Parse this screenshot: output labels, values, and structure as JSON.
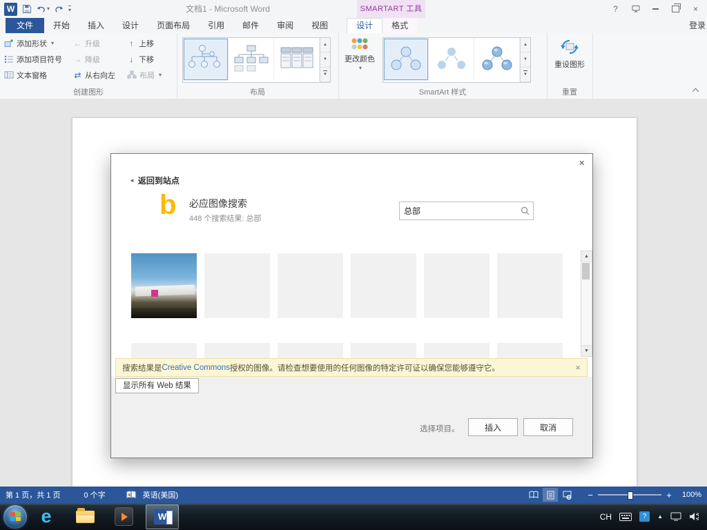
{
  "window": {
    "title": "文档1 - Microsoft Word",
    "contextual_tool_label": "SMARTART 工具",
    "sign_in": "登录"
  },
  "glyphs": {
    "close": "×",
    "dropdown": "▾",
    "up": "▲",
    "down": "▼",
    "back": "◄",
    "minus": "−",
    "plus": "+",
    "help": "?"
  },
  "logos": {
    "word": "W",
    "ie": "e",
    "bing": "b"
  },
  "tabs": {
    "file": "文件",
    "main": [
      "开始",
      "插入",
      "设计",
      "页面布局",
      "引用",
      "邮件",
      "审阅",
      "视图"
    ],
    "contextual_design": "设计",
    "contextual_format": "格式"
  },
  "ribbon": {
    "groups": [
      {
        "name": "创建图形"
      },
      {
        "name": "布局"
      },
      {
        "name": "SmartArt 样式"
      },
      {
        "name": "重置"
      }
    ],
    "create_graphic": {
      "add_shape": "添加形状",
      "add_bullet": "添加项目符号",
      "text_pane": "文本窗格",
      "promote": "升级",
      "demote": "降级",
      "right_to_left": "从右向左",
      "move_up": "上移",
      "move_down": "下移",
      "layout": "布局"
    },
    "smartart_styles": {
      "change_colors": "更改颜色"
    },
    "reset": {
      "reset_graphic": "重设图形"
    }
  },
  "dialog": {
    "back_label": "返回到站点",
    "provider_title": "必应图像搜索",
    "results_summary": "448 个搜索结果: 总部",
    "search": {
      "value": "总部"
    },
    "notice": {
      "prefix": "搜索结果是 ",
      "link": "Creative Commons",
      "suffix": " 授权的图像。请检查想要使用的任何图像的特定许可证以确保您能够遵守它。"
    },
    "show_all_results": "显示所有 Web 结果",
    "selection_hint": "选择项目。",
    "insert_label": "插入",
    "cancel_label": "取消"
  },
  "status_bar": {
    "page_info": "第 1 页，共 1 页",
    "word_count": "0 个字",
    "language": "英语(美国)",
    "zoom": "100%"
  },
  "taskbar": {
    "input_indicator": "CH"
  },
  "colors": {
    "accent_blue": "#2b579a",
    "contextual_purple": "#93389e",
    "bing_yellow": "#ffb900",
    "notice_yellow": "#fbf6d5",
    "status_bar": "#2b579a"
  }
}
